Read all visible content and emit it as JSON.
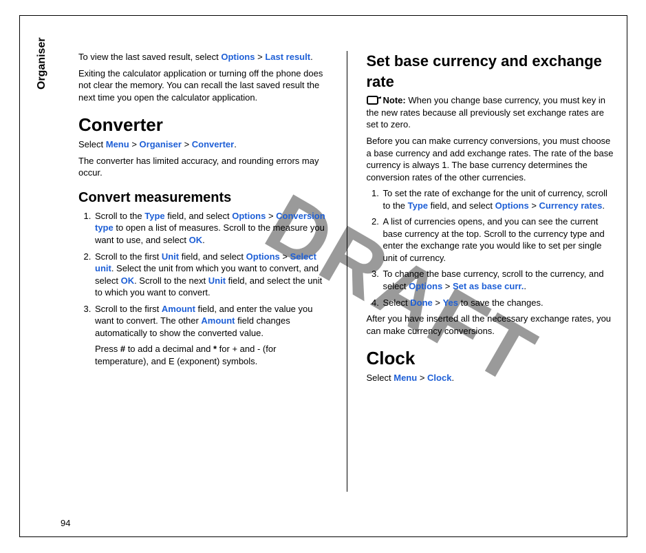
{
  "sideLabel": "Organiser",
  "pageNumber": "94",
  "watermark": "DRAFT",
  "col1": {
    "p1_a": "To view the last saved result, select ",
    "p1_opt": "Options",
    "p1_gt": " > ",
    "p1_last": "Last result",
    "p1_end": ".",
    "p2": "Exiting the calculator application or turning off the phone does not clear the memory. You can recall the last saved result the next time you open the calculator application.",
    "h1_converter": "Converter",
    "p3_a": "Select ",
    "p3_menu": "Menu",
    "p3_gt1": " > ",
    "p3_org": "Organiser",
    "p3_gt2": " > ",
    "p3_conv": "Converter",
    "p3_end": ".",
    "p4": "The converter has limited accuracy, and rounding errors may occur.",
    "h2_convert": "Convert measurements",
    "li1_a": "Scroll to the ",
    "li1_type": "Type",
    "li1_b": " field, and select ",
    "li1_opt": "Options",
    "li1_gt": " > ",
    "li1_ct": "Conversion type",
    "li1_c": " to open a list of measures. Scroll to the measure you want to use, and select ",
    "li1_ok": "OK",
    "li1_end": ".",
    "li2_a": "Scroll to the first ",
    "li2_unit": "Unit",
    "li2_b": " field, and select ",
    "li2_opt": "Options",
    "li2_gt": " > ",
    "li2_su": "Select unit",
    "li2_c": ". Select the unit from which you want to convert, and select ",
    "li2_ok": "OK",
    "li2_d": ". Scroll to the next ",
    "li2_unit2": "Unit",
    "li2_e": " field, and select the unit to which you want to convert.",
    "li3_a": "Scroll to the first ",
    "li3_amt": "Amount",
    "li3_b": " field, and enter the value you want to convert. The other ",
    "li3_amt2": "Amount",
    "li3_c": " field changes automatically to show the converted value.",
    "li3_sub_a": "Press ",
    "li3_hash": "#",
    "li3_sub_b": " to add a decimal and ",
    "li3_star": "*",
    "li3_sub_c": " for + and - (for temperature), and E (exponent) symbols."
  },
  "col2": {
    "h2_base": "Set base currency and exchange rate",
    "note_label": "Note:",
    "note_text": "  When you change base currency, you must key in the new rates because all previously set exchange rates are set to zero.",
    "p1": "Before you can make currency conversions, you must choose a base currency and add exchange rates. The rate of the base currency is always 1. The base currency determines the conversion rates of the other currencies.",
    "li1_a": "To set the rate of exchange for the unit of currency, scroll to the ",
    "li1_type": "Type",
    "li1_b": " field, and select ",
    "li1_opt": "Options",
    "li1_gt": " > ",
    "li1_cr": "Currency rates",
    "li1_end": ".",
    "li2": "A list of currencies opens, and you can see the current base currency at the top. Scroll to the currency type and enter the exchange rate you would like to set per single unit of currency.",
    "li3_a": "To change the base currency, scroll to the currency, and select ",
    "li3_opt": "Options",
    "li3_gt": " > ",
    "li3_sbc": "Set as base curr.",
    "li3_end": ".",
    "li4_a": "Select ",
    "li4_done": "Done",
    "li4_gt": " > ",
    "li4_yes": "Yes",
    "li4_b": " to save the changes.",
    "p2": "After you have inserted all the necessary exchange rates, you can make currency conversions.",
    "h1_clock": "Clock",
    "p3_a": "Select ",
    "p3_menu": "Menu",
    "p3_gt": " > ",
    "p3_clock": "Clock",
    "p3_end": "."
  }
}
